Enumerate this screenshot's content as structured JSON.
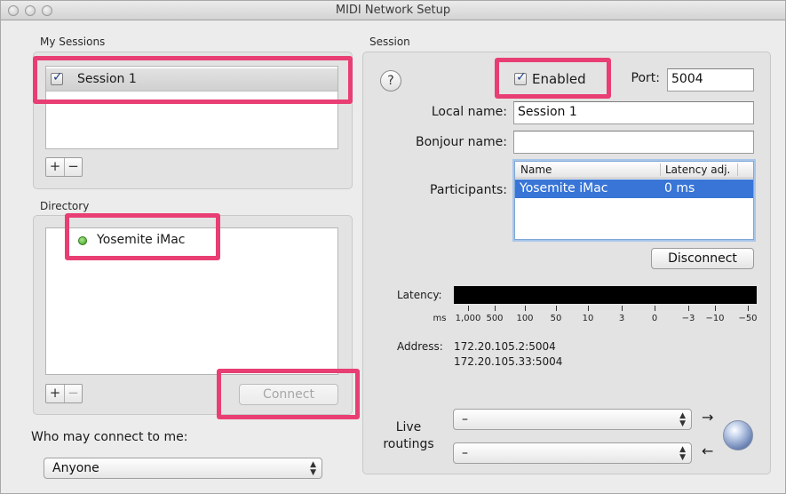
{
  "window": {
    "title": "MIDI Network Setup"
  },
  "my_sessions": {
    "label": "My Sessions",
    "items": [
      {
        "name": "Session 1",
        "checked": true
      }
    ],
    "add_label": "+",
    "remove_label": "−"
  },
  "directory": {
    "label": "Directory",
    "items": [
      {
        "name": "Yosemite iMac",
        "status": "online",
        "status_color": "#4caf2a"
      }
    ],
    "add_label": "+",
    "remove_label": "−",
    "connect_label": "Connect"
  },
  "who_may_connect": {
    "label": "Who may connect to me:",
    "selected": "Anyone"
  },
  "session": {
    "label": "Session",
    "help_label": "?",
    "enabled_label": "Enabled",
    "enabled": true,
    "port_label": "Port:",
    "port_value": "5004",
    "local_name_label": "Local name:",
    "local_name_value": "Session 1",
    "bonjour_name_label": "Bonjour name:",
    "bonjour_name_value": "",
    "participants_label": "Participants:",
    "participants_columns": [
      "Name",
      "Latency adj."
    ],
    "participants_rows": [
      {
        "name": "Yosemite iMac",
        "latency": "0 ms"
      }
    ],
    "disconnect_label": "Disconnect",
    "latency_label": "Latency:",
    "latency_unit": "ms",
    "latency_scale": [
      "1,000",
      "500",
      "100",
      "50",
      "10",
      "3",
      "0",
      "−3",
      "−10",
      "−50"
    ],
    "address_label": "Address:",
    "addresses": [
      "172.20.105.2:5004",
      "172.20.105.33:5004"
    ],
    "live_routings_label_line1": "Live",
    "live_routings_label_line2": "routings",
    "routing_in_value": "–",
    "routing_out_value": "–",
    "arrow_out": "→",
    "arrow_in": "←"
  },
  "colors": {
    "highlight": "#e83e73",
    "selection": "#3875d7"
  },
  "icons": [
    "checkbox-checked-icon",
    "status-online-icon",
    "help-icon",
    "network-globe-icon",
    "popup-arrows-icon"
  ]
}
